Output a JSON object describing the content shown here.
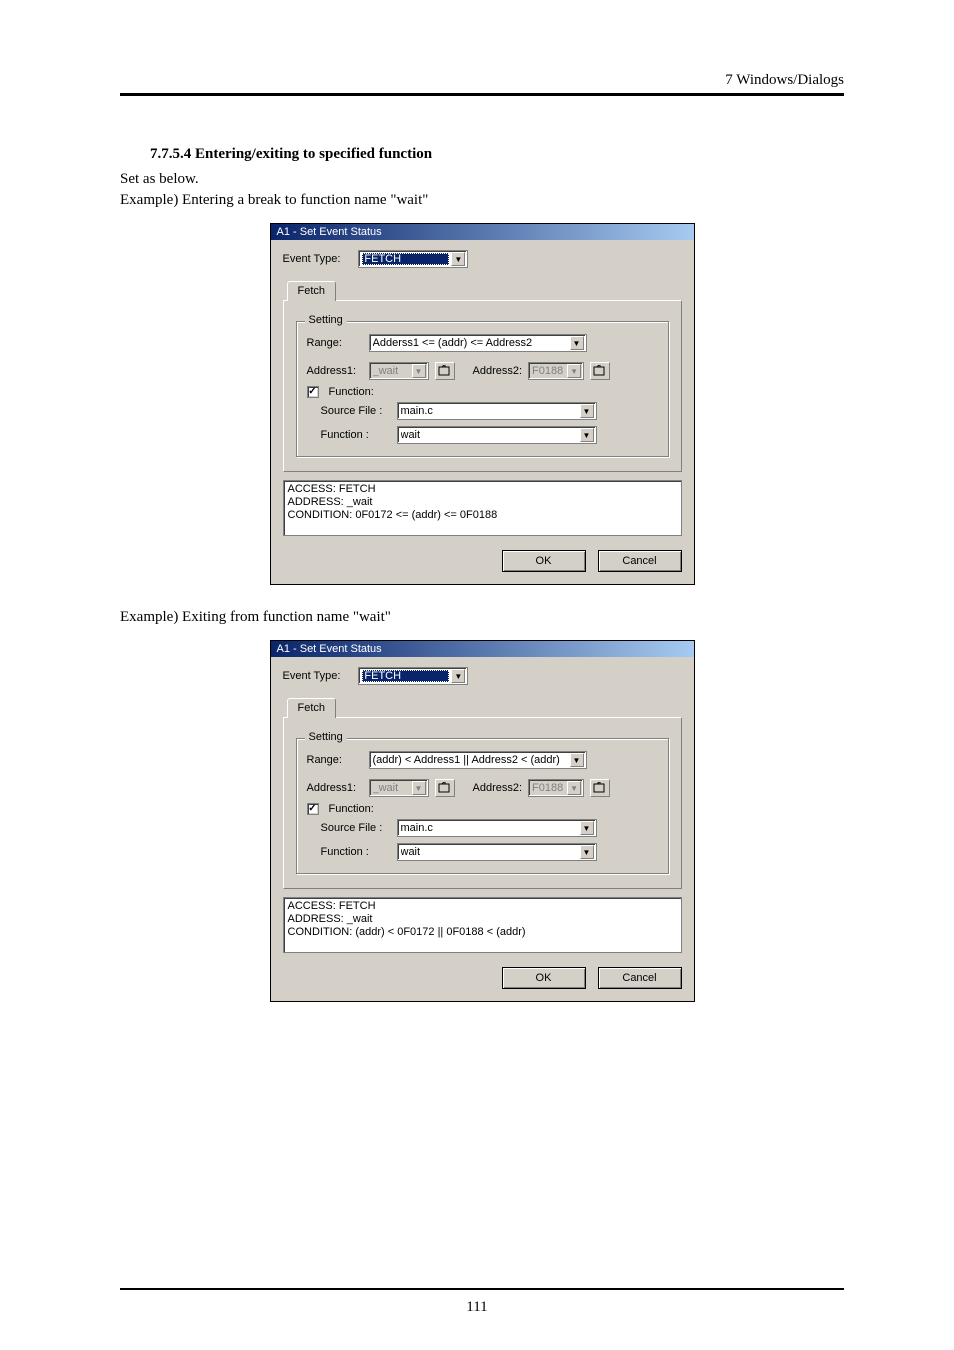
{
  "header": {
    "chapter": "7  Windows/Dialogs"
  },
  "section": {
    "heading": "7.7.5.4 Entering/exiting to specified function",
    "intro": "Set as below.",
    "example1_caption": "Example) Entering a break to function name \"wait\"",
    "example2_caption": "Example) Exiting from function name \"wait\""
  },
  "dlg1": {
    "title": "A1 - Set Event Status",
    "eventtype_label": "Event Type:",
    "eventtype_value": "FETCH",
    "tab": "Fetch",
    "group_legend": "Setting",
    "range_label": "Range:",
    "range_value": "Adderss1 <= (addr) <= Address2",
    "addr1_label": "Address1:",
    "addr1_value": "_wait",
    "addr2_label": "Address2:",
    "addr2_value": "F0188",
    "function_checkbox": "Function:",
    "sourcefile_label": "Source File :",
    "sourcefile_value": "main.c",
    "function_label": "Function :",
    "function_value": "wait",
    "status_lines": "ACCESS: FETCH\nADDRESS: _wait\nCONDITION: 0F0172 <= (addr) <= 0F0188",
    "ok": "OK",
    "cancel": "Cancel"
  },
  "dlg2": {
    "title": "A1 - Set Event Status",
    "eventtype_label": "Event Type:",
    "eventtype_value": "FETCH",
    "tab": "Fetch",
    "group_legend": "Setting",
    "range_label": "Range:",
    "range_value": "(addr) < Address1 || Address2 < (addr)",
    "addr1_label": "Address1:",
    "addr1_value": "_wait",
    "addr2_label": "Address2:",
    "addr2_value": "F0188",
    "function_checkbox": "Function:",
    "sourcefile_label": "Source File :",
    "sourcefile_value": "main.c",
    "function_label": "Function :",
    "function_value": "wait",
    "status_lines": "ACCESS: FETCH\nADDRESS: _wait\nCONDITION: (addr) < 0F0172 || 0F0188 < (addr)",
    "ok": "OK",
    "cancel": "Cancel"
  },
  "footer": {
    "page_number": "111"
  }
}
